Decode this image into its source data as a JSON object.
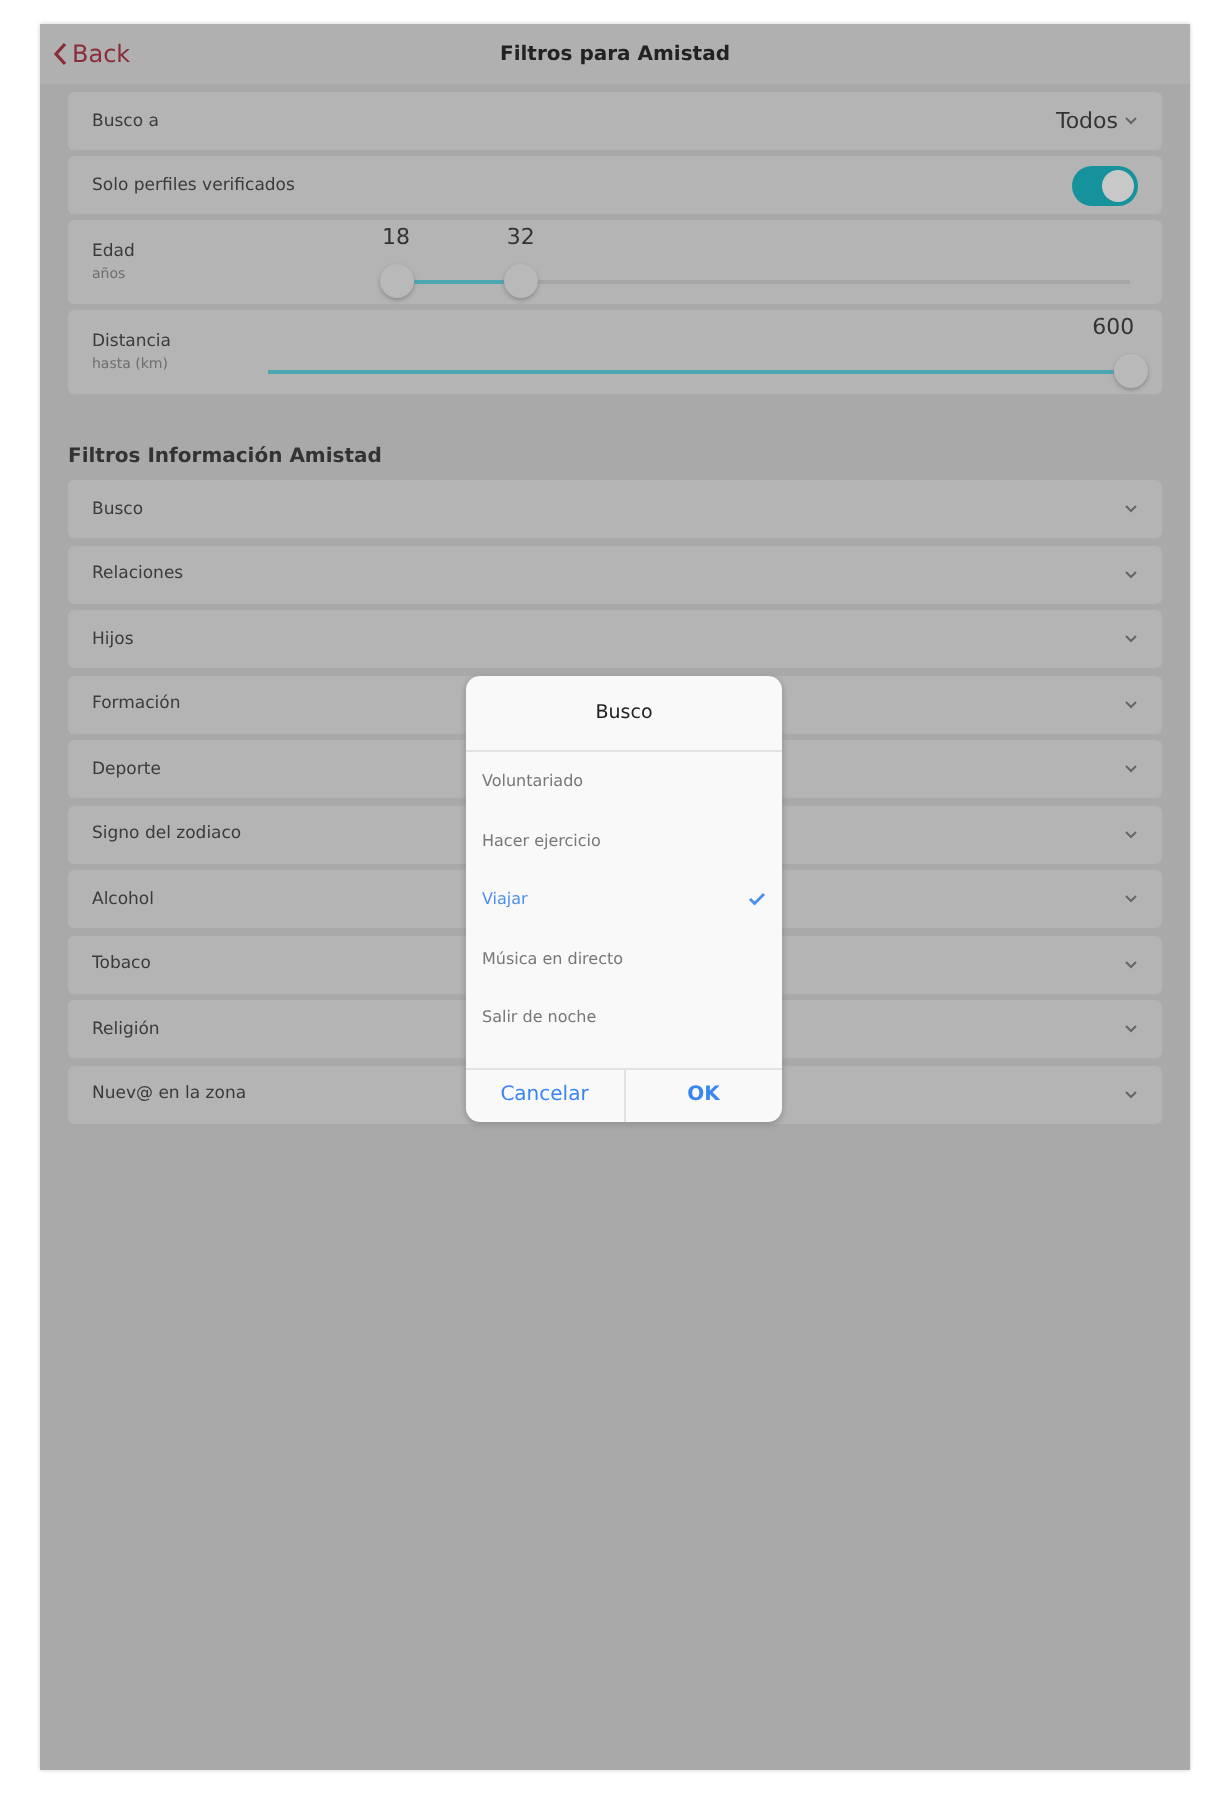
{
  "nav": {
    "back": "Back",
    "title": "Filtros para Amistad"
  },
  "settings": [
    {
      "kind": "select",
      "label": "Busco a",
      "value": "Todos"
    },
    {
      "kind": "toggle",
      "label": "Solo perfiles verificados",
      "on": true
    },
    {
      "kind": "range",
      "label": "Edad",
      "sublabel": "años",
      "thumbs": [
        {
          "reading": "18",
          "level": 0
        },
        {
          "reading": "32",
          "level": 0.17
        }
      ]
    },
    {
      "kind": "slider",
      "label": "Distancia",
      "sublabel": "hasta (km)",
      "reading": "600",
      "level": 1
    }
  ],
  "section_title": "Filtros Información Amistad",
  "filters": [
    {
      "label": "Busco"
    },
    {
      "label": "Relaciones"
    },
    {
      "label": "Hijos"
    },
    {
      "label": "Formación"
    },
    {
      "label": "Deporte"
    },
    {
      "label": "Signo del zodiaco"
    },
    {
      "label": "Alcohol"
    },
    {
      "label": "Tobaco"
    },
    {
      "label": "Religión"
    },
    {
      "label": "Nuev@ en la zona"
    }
  ],
  "dialog": {
    "title": "Busco",
    "options": [
      {
        "label": "Voluntariado",
        "selected": false
      },
      {
        "label": "Hacer ejercicio",
        "selected": false
      },
      {
        "label": "Viajar",
        "selected": true
      },
      {
        "label": "Música en directo",
        "selected": false
      },
      {
        "label": "Salir de noche",
        "selected": false
      }
    ],
    "buttons": [
      "Cancelar",
      "OK"
    ]
  }
}
